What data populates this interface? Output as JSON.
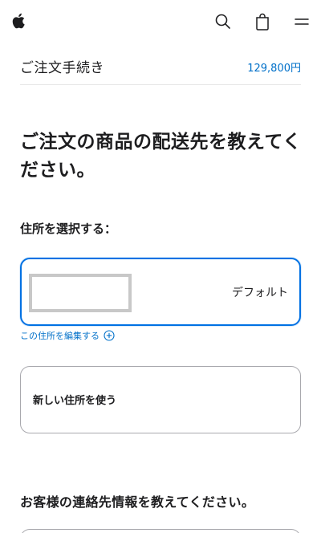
{
  "nav": {
    "icons": [
      "apple-logo",
      "search-icon",
      "bag-icon",
      "menu-icon"
    ]
  },
  "checkout": {
    "title": "ご注文手続き",
    "total": "129,800円"
  },
  "shipping": {
    "heading": "ご注文の商品の配送先を教えてください。",
    "select_label": "住所を選択する：",
    "selected_address": {
      "badge": "デフォルト"
    },
    "edit_link": "この住所を編集する",
    "new_address": "新しい住所を使う"
  },
  "contact": {
    "heading": "お客様の連絡先情報を教えてください。"
  },
  "colors": {
    "accent": "#0071e3",
    "link": "#0070c9",
    "text": "#1d1d1f",
    "border": "#a9a9ae"
  }
}
